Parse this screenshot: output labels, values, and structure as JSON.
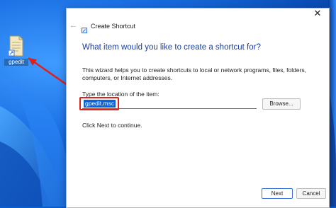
{
  "desktop": {
    "icon_label": "gpedit",
    "accent_colors": {
      "wallpaper_blue": "#1a6fe3",
      "annotation_red": "#e0201a"
    }
  },
  "dialog": {
    "title": "Create Shortcut",
    "heading": "What item would you like to create a shortcut for?",
    "description": "This wizard helps you to create shortcuts to local or network programs, files, folders, computers, or Internet addresses.",
    "location_label": "Type the location of the item:",
    "location_value": "gpedit.msc",
    "browse_label": "Browse...",
    "next_hint": "Click Next to continue.",
    "next_label": "Next",
    "cancel_label": "Cancel",
    "close_glyph": "✕",
    "back_glyph": "←"
  }
}
